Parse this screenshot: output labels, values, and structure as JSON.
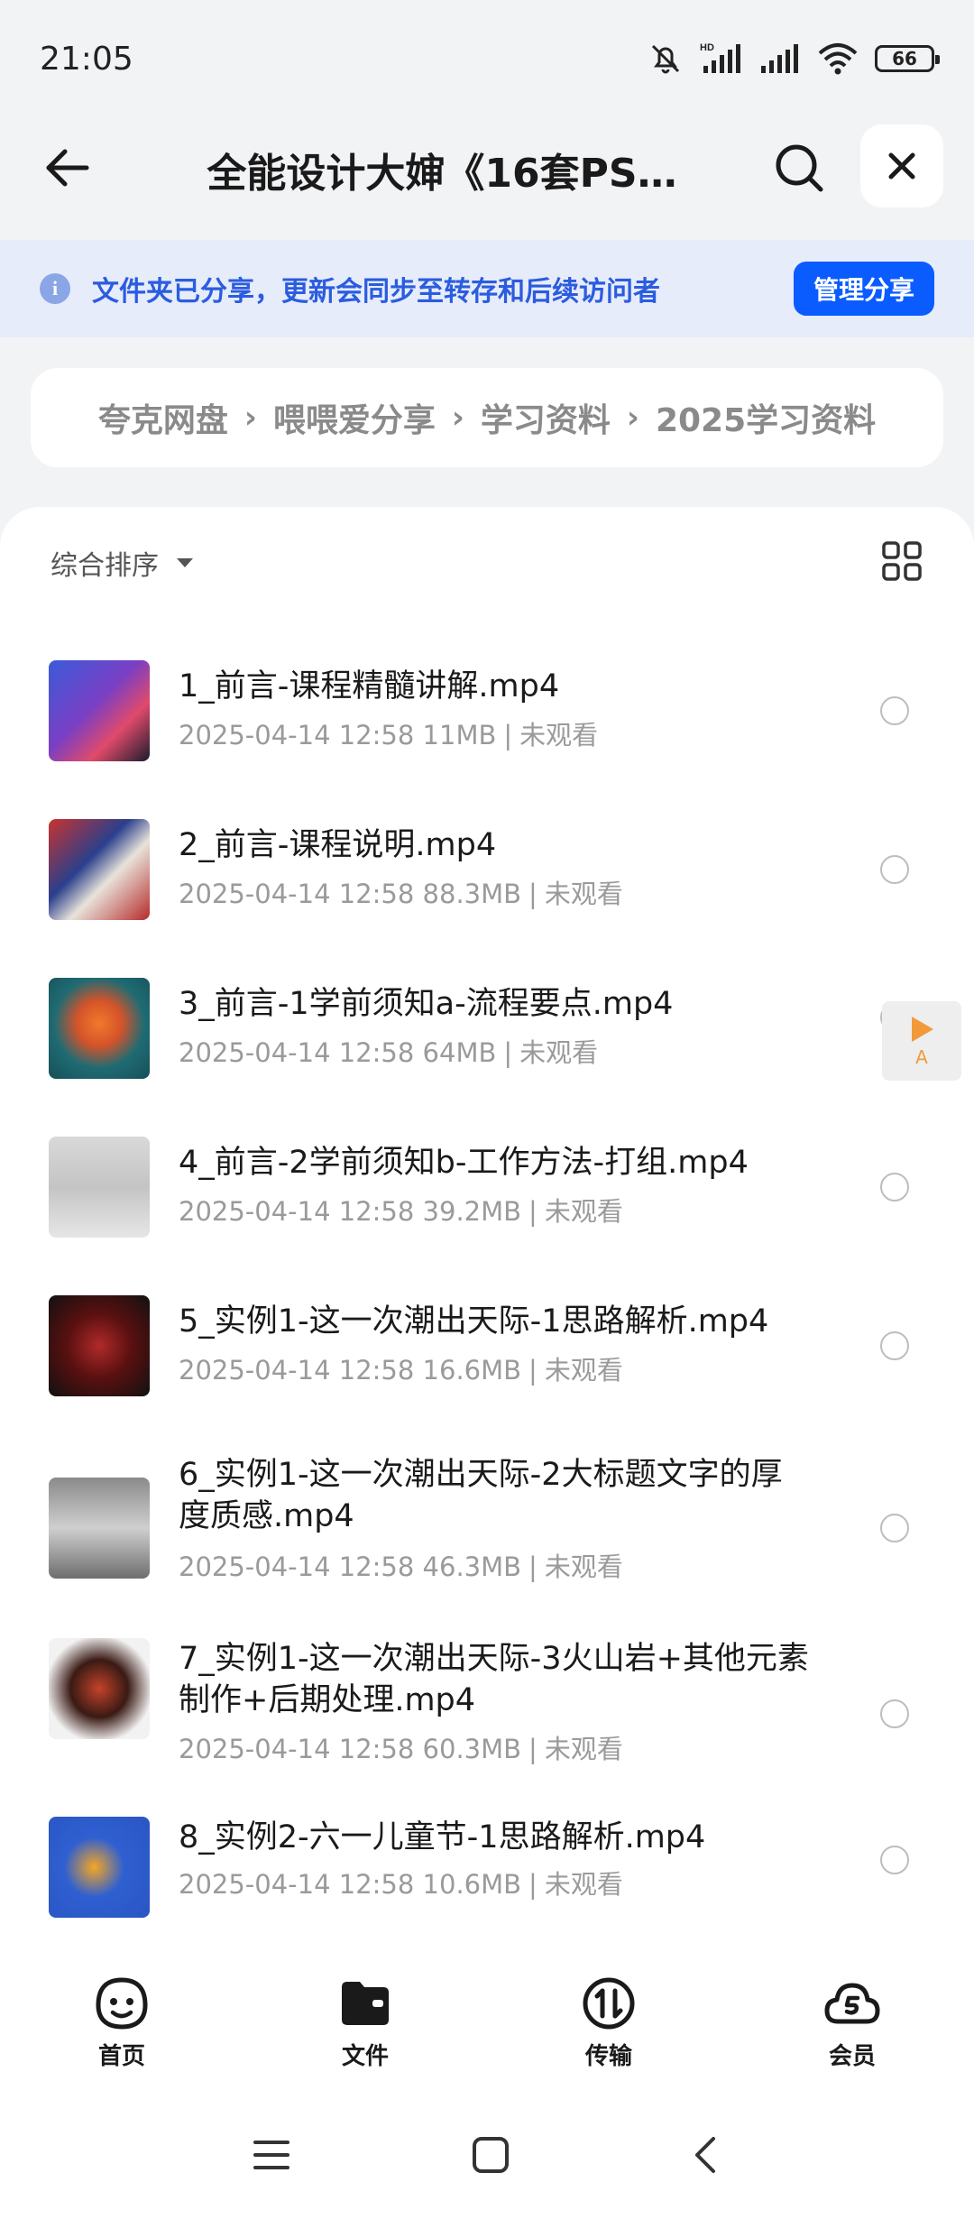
{
  "status_bar": {
    "time": "21:05",
    "network_label": "HD",
    "battery": "66"
  },
  "header": {
    "title": "全能设计大婶《16套PS…"
  },
  "banner": {
    "text": "文件夹已分享，更新会同步至转存和后续访问者",
    "manage_label": "管理分享"
  },
  "breadcrumb": {
    "items": [
      "夸克网盘",
      "喂喂爱分享",
      "学习资料",
      "2025学习资料"
    ],
    "separator": "›"
  },
  "list": {
    "sort_label": "综合排序",
    "files": [
      {
        "name": "1_前言-课程精髓讲解.mp4",
        "date": "2025-04-14 12:58",
        "size": "11MB",
        "status": "未观看"
      },
      {
        "name": "2_前言-课程说明.mp4",
        "date": "2025-04-14 12:58",
        "size": "88.3MB",
        "status": "未观看"
      },
      {
        "name": "3_前言-1学前须知a-流程要点.mp4",
        "date": "2025-04-14 12:58",
        "size": "64MB",
        "status": "未观看"
      },
      {
        "name": "4_前言-2学前须知b-工作方法-打组.mp4",
        "date": "2025-04-14 12:58",
        "size": "39.2MB",
        "status": "未观看"
      },
      {
        "name": "5_实例1-这一次潮出天际-1思路解析.mp4",
        "date": "2025-04-14 12:58",
        "size": "16.6MB",
        "status": "未观看"
      },
      {
        "name": "6_实例1-这一次潮出天际-2大标题文字的厚度质感.mp4",
        "date": "2025-04-14 12:58",
        "size": "46.3MB",
        "status": "未观看"
      },
      {
        "name": "7_实例1-这一次潮出天际-3火山岩+其他元素制作+后期处理.mp4",
        "date": "2025-04-14 12:58",
        "size": "60.3MB",
        "status": "未观看"
      },
      {
        "name": "8_实例2-六一儿童节-1思路解析.mp4",
        "date": "2025-04-14 12:58",
        "size": "10.6MB",
        "status": "未观看"
      }
    ]
  },
  "float_widget": {
    "label": "A"
  },
  "bottom_nav": {
    "items": [
      {
        "label": "首页",
        "icon": "smile-face-icon"
      },
      {
        "label": "文件",
        "icon": "folder-icon"
      },
      {
        "label": "传输",
        "icon": "transfer-icon"
      },
      {
        "label": "会员",
        "icon": "cloud-vip-icon"
      }
    ]
  },
  "colors": {
    "accent": "#0b5cff",
    "banner_bg": "#e6ecf9",
    "banner_text": "#2b5ce0",
    "muted_text": "#9a9a9a"
  }
}
